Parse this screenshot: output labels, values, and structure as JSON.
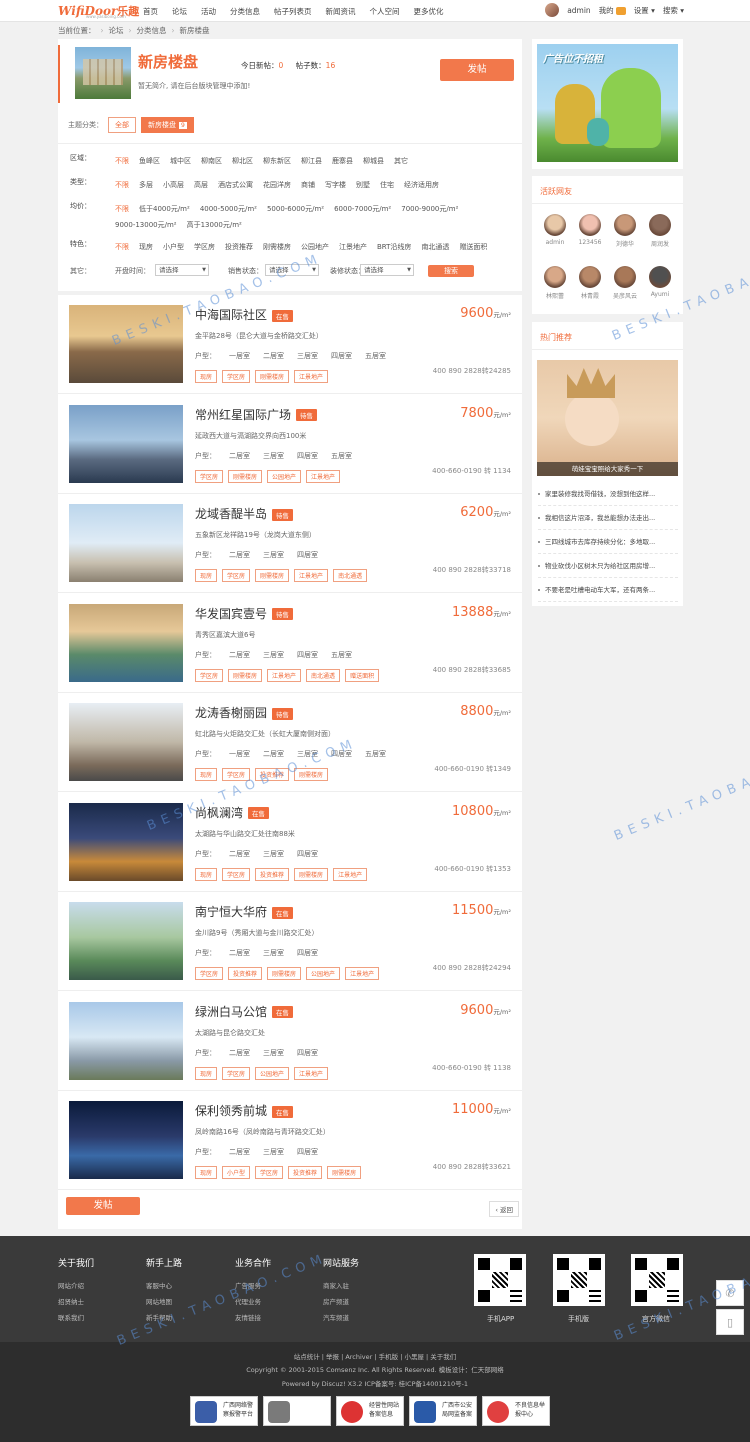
{
  "header": {
    "logo_en": "WifiDoor",
    "logo_cn": "乐趣",
    "logo_sub": "www.yasiboing.com",
    "nav": [
      "首页",
      "论坛",
      "活动",
      "分类信息",
      "帖子列表页",
      "新闻资讯",
      "个人空间",
      "更多优化"
    ],
    "username": "admin",
    "my": "我的",
    "settings": "设置",
    "search": "搜索"
  },
  "breadcrumb": [
    "当前位置：",
    "论坛",
    "分类信息",
    "新房楼盘"
  ],
  "forum": {
    "title": "新房楼盘",
    "today_label": "今日新帖：",
    "today_value": "0",
    "posts_label": "帖子数：",
    "posts_value": "16",
    "desc": "暂无简介, 请在后台版块管理中添加!",
    "post_button": "发帖",
    "category_label": "主题分类：",
    "category_all": "全部",
    "category_current": "新房楼盘",
    "category_count": "9"
  },
  "filters": [
    {
      "label": "区域：",
      "options": [
        "不限",
        "鱼峰区",
        "城中区",
        "柳南区",
        "柳北区",
        "柳东新区",
        "柳江县",
        "鹿寨县",
        "柳城县",
        "其它"
      ]
    },
    {
      "label": "类型：",
      "options": [
        "不限",
        "多层",
        "小高层",
        "高层",
        "酒店式公寓",
        "花园洋房",
        "商铺",
        "写字楼",
        "别墅",
        "住宅",
        "经济适用房"
      ]
    },
    {
      "label": "均价：",
      "options": [
        "不限",
        "低于4000元/m²",
        "4000-5000元/m²",
        "5000-6000元/m²",
        "6000-7000元/m²",
        "7000-9000元/m²",
        "9000-13000元/m²",
        "高于13000元/m²"
      ]
    },
    {
      "label": "特色：",
      "options": [
        "不限",
        "现房",
        "小户型",
        "学区房",
        "投资推荐",
        "刚需楼房",
        "公园地产",
        "江景地产",
        "BRT沿线房",
        "南北通透",
        "赠送面积"
      ]
    }
  ],
  "other_filter": {
    "label": "其它：",
    "open_time_label": "开盘时间：",
    "sale_label": "销售状态：",
    "decor_label": "装修状态：",
    "placeholder": "请选择",
    "search_button": "搜索"
  },
  "colors": {
    "accent": "#f06b3a",
    "on_sale": "#f06b3a",
    "pending": "#f06b3a"
  },
  "listings": [
    {
      "title": "中海国际社区",
      "status": "在售",
      "address": "金平路28号（昆仑大道与金桥路交汇处）",
      "rooms": [
        "户型：",
        "一居室",
        "二居室",
        "三居室",
        "四居室",
        "五居室"
      ],
      "tags": [
        "现房",
        "学区房",
        "刚需楼房",
        "江景地产"
      ],
      "price": "9600",
      "unit": "元/m²",
      "phone": "400 890 2828转24285"
    },
    {
      "title": "常州红星国际广场",
      "status": "待售",
      "address": "延政西大道与滆湖路交界向西100米",
      "rooms": [
        "户型：",
        "二居室",
        "三居室",
        "四居室",
        "五居室"
      ],
      "tags": [
        "学区房",
        "刚需楼房",
        "公园地产",
        "江景地产"
      ],
      "price": "7800",
      "unit": "元/m²",
      "phone": "400-660-0190 转 1134"
    },
    {
      "title": "龙域香醍半岛",
      "status": "待售",
      "address": "五象新区龙祥路19号（龙岗大道东侧）",
      "rooms": [
        "户型：",
        "二居室",
        "三居室",
        "四居室"
      ],
      "tags": [
        "现房",
        "学区房",
        "刚需楼房",
        "江景地产",
        "南北通透"
      ],
      "price": "6200",
      "unit": "元/m²",
      "phone": "400 890 2828转33718"
    },
    {
      "title": "华发国宾壹号",
      "status": "待售",
      "address": "青秀区嘉滨大道6号",
      "rooms": [
        "户型：",
        "二居室",
        "三居室",
        "四居室",
        "五居室"
      ],
      "tags": [
        "学区房",
        "刚需楼房",
        "江景地产",
        "南北通透",
        "赠送面积"
      ],
      "price": "13888",
      "unit": "元/m²",
      "phone": "400 890 2828转33685"
    },
    {
      "title": "龙涛香榭丽园",
      "status": "待售",
      "address": "虹北路与火炬路交汇处（长虹大厦南侧对面）",
      "rooms": [
        "户型：",
        "一居室",
        "二居室",
        "三居室",
        "四居室",
        "五居室"
      ],
      "tags": [
        "现房",
        "学区房",
        "投资推荐",
        "刚需楼房"
      ],
      "price": "8800",
      "unit": "元/m²",
      "phone": "400-660-0190 转1349"
    },
    {
      "title": "尚枫澜湾",
      "status": "在售",
      "address": "太湖路与华山路交汇处往南88米",
      "rooms": [
        "户型：",
        "二居室",
        "三居室",
        "四居室"
      ],
      "tags": [
        "现房",
        "学区房",
        "投资推荐",
        "刚需楼房",
        "江景地产"
      ],
      "price": "10800",
      "unit": "元/m²",
      "phone": "400-660-0190 转1353"
    },
    {
      "title": "南宁恒大华府",
      "status": "在售",
      "address": "金川路9号（秀厢大道与金川路交汇处）",
      "rooms": [
        "户型：",
        "二居室",
        "三居室",
        "四居室"
      ],
      "tags": [
        "学区房",
        "投资推荐",
        "刚需楼房",
        "公园地产",
        "江景地产"
      ],
      "price": "11500",
      "unit": "元/m²",
      "phone": "400 890 2828转24294"
    },
    {
      "title": "绿洲白马公馆",
      "status": "在售",
      "address": "太湖路与昆仑路交汇处",
      "rooms": [
        "户型：",
        "二居室",
        "三居室",
        "四居室"
      ],
      "tags": [
        "现房",
        "学区房",
        "公园地产",
        "江景地产"
      ],
      "price": "9600",
      "unit": "元/m²",
      "phone": "400-660-0190 转 1138"
    },
    {
      "title": "保利领秀前城",
      "status": "在售",
      "address": "凤岭南路16号（凤岭南路与青环路交汇处）",
      "rooms": [
        "户型：",
        "二居室",
        "三居室",
        "四居室"
      ],
      "tags": [
        "现房",
        "小户型",
        "学区房",
        "投资推荐",
        "刚需楼房"
      ],
      "price": "11000",
      "unit": "元/m²",
      "phone": "400 890 2828转33621"
    }
  ],
  "list_footer": {
    "post_button": "发帖",
    "back": "返回"
  },
  "sidebar": {
    "ad_text": "广告位不招租",
    "friends_title": "活跃网友",
    "friends": [
      "admin",
      "123456",
      "刘德华",
      "周润发",
      "林熙蕾",
      "林青霞",
      "吴彦风云",
      "Ayumi"
    ],
    "hot_title": "热门推荐",
    "hot_caption": "萌娃宝宝照给大家秀一下",
    "hot_list": [
      "家里装修我找哥借钱，没想到他这样...",
      "我相信这片沼泽，我总能想办法走出...",
      "三四线城市去库存持续分化：多地取...",
      "物业砍伐小区树木只为给社区用房增...",
      "不要老是吐槽电动车大军，还有两条..."
    ]
  },
  "footer": {
    "cols": [
      {
        "title": "关于我们",
        "links": [
          "网站介绍",
          "招贤纳士",
          "联系我们"
        ]
      },
      {
        "title": "新手上路",
        "links": [
          "客服中心",
          "网站地图",
          "新手帮助"
        ]
      },
      {
        "title": "业务合作",
        "links": [
          "广告服务",
          "代理业务",
          "友情链接"
        ]
      },
      {
        "title": "网站服务",
        "links": [
          "商家入驻",
          "房产频道",
          "汽车频道"
        ]
      }
    ],
    "qr_labels": [
      "手机APP",
      "手机版",
      "官方微信"
    ],
    "links_line": "站点统计 | 举报 | Archiver | 手机版 | 小黑屋 | 关于我们",
    "copyright": "Copyright © 2001-2015 Comsenz Inc. All Rights Reserved.   模板设计：仁天部网络",
    "powered": "Powered by Discuz! X3.2  ICP备案号: 桂ICP备14001210号-1",
    "certs": [
      "广西网络警察报警平台",
      "",
      "经营性网站备案信息",
      "广西市公安局网监备案",
      "不良信息举报中心"
    ]
  },
  "watermark": "BESKI.TAOBAO.COM"
}
